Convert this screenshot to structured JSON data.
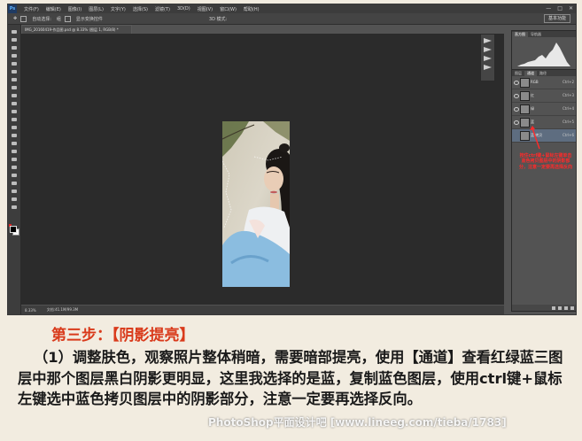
{
  "app": {
    "logo": "Ps",
    "menu": [
      "文件(F)",
      "编辑(E)",
      "图像(I)",
      "图层(L)",
      "文字(Y)",
      "选择(S)",
      "滤镜(T)",
      "3D(D)",
      "视图(V)",
      "窗口(W)",
      "帮助(H)"
    ],
    "window_controls": [
      "—",
      "□",
      "✕"
    ]
  },
  "options_bar": {
    "auto_select_label": "自动选择:",
    "auto_select_value": "组",
    "show_transform_label": "显示变换控件",
    "mode_3d_label": "3D 模式:",
    "right_button": "基本功能"
  },
  "document": {
    "tab_title": "IMG_20160419-作品图.psd @ 8.33% (图层 1, RGB/8) *",
    "zoom": "8.33%",
    "doc_size": "文档:41.1M/99.3M"
  },
  "panels": {
    "histogram_tabs": [
      "直方图",
      "导航器"
    ],
    "channels_tabs": [
      "图层",
      "通道",
      "路径"
    ],
    "channels": [
      {
        "name": "RGB",
        "shortcut": "Ctrl+2"
      },
      {
        "name": "红",
        "shortcut": "Ctrl+3"
      },
      {
        "name": "绿",
        "shortcut": "Ctrl+4"
      },
      {
        "name": "蓝",
        "shortcut": "Ctrl+5"
      },
      {
        "name": "蓝 拷贝",
        "shortcut": "Ctrl+6"
      }
    ],
    "annotation": "按住ctrl键+鼠标左键单击蓝色拷贝图层中的阴影部分，注意一定要再选择反向"
  },
  "tutorial": {
    "step_title": "第三步：【阴影提亮】",
    "body": "（1）调整肤色，观察照片整体稍暗，需要暗部提亮，使用【通道】查看红绿蓝三图层中那个图层黑白阴影更明显，这里我选择的是蓝，复制蓝色图层，使用ctrl键+鼠标左键选中蓝色拷贝图层中的阴影部分，注意一定要再选择反向。",
    "watermark": "PhotoShop平面设计吧 [www.lineeg.com/tieba/1783]"
  },
  "colors": {
    "accent_red": "#d93a1b",
    "ps_dark": "#535353",
    "canvas": "#2b2b2b"
  }
}
